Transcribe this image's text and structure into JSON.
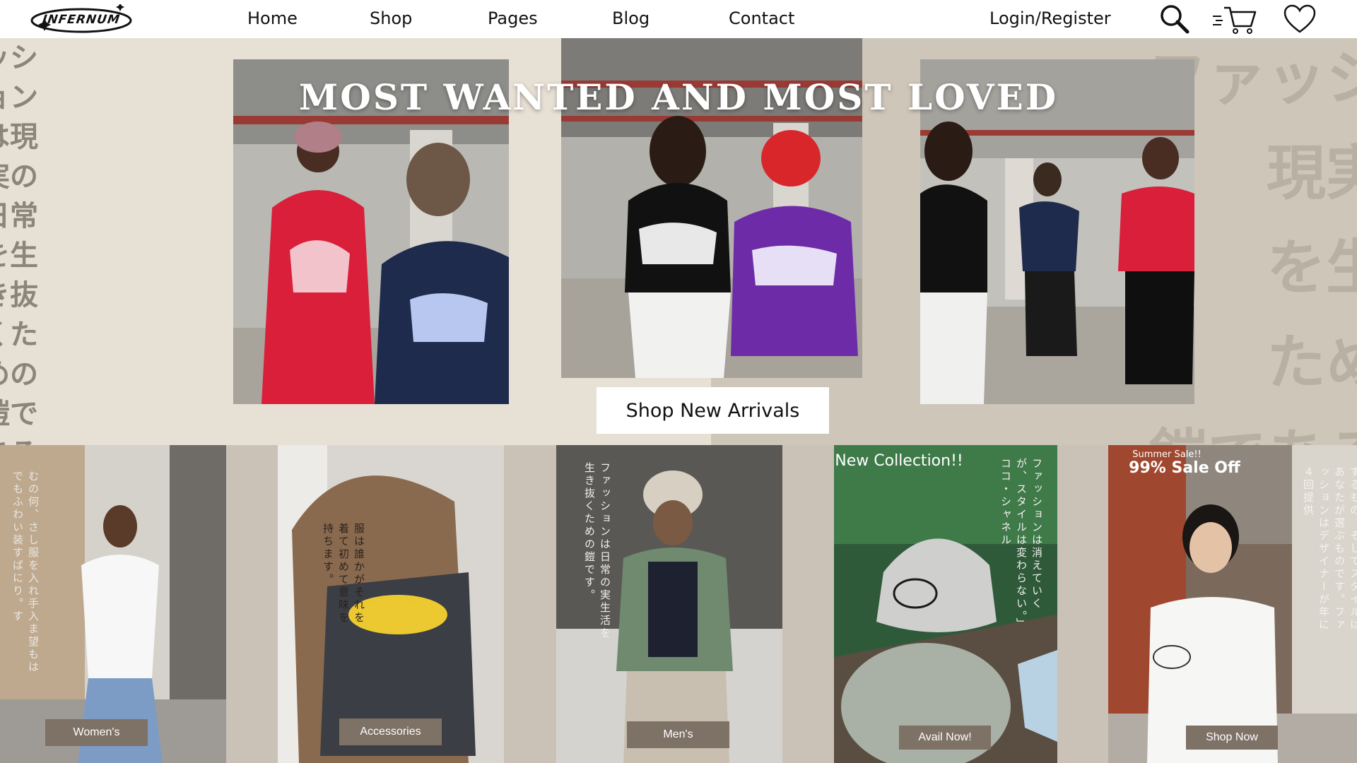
{
  "brand": {
    "logo_text": "INFERNUM"
  },
  "nav": {
    "links": [
      "Home",
      "Shop",
      "Pages",
      "Blog",
      "Contact"
    ],
    "login_label": "Login/Register",
    "icons": [
      "search-icon",
      "cart-icon",
      "heart-icon"
    ]
  },
  "hero": {
    "title": "MOST WANTED AND MOST LOVED",
    "cta_label": "Shop New Arrivals",
    "jp_left_lines": [
      "ッシ",
      "ョン",
      "は現",
      "実の",
      "日常",
      "を生",
      "き抜",
      "くた",
      "めの",
      "鎧で",
      "ある"
    ],
    "jp_right_lines": [
      "ファッシ",
      "現実",
      "を生",
      "ため",
      "鎧である"
    ]
  },
  "categories": [
    {
      "button": "Women's",
      "vertical_text": "むの何、さし服を入れ手入ま望もはでもふわい装すばにり。す"
    },
    {
      "button": "Accessories",
      "vertical_text": "服は誰かがそれを着て初めて意味を持ちます。"
    },
    {
      "button": "Men's",
      "vertical_text": "ファッションは日常の実生活を生き抜くための鎧です。"
    },
    {
      "button": "Avail Now!",
      "title": "New Collection!!",
      "vertical_text": "ファッションは消えていくが、スタイルは変わらない。」ココ・シャネル"
    },
    {
      "button": "Shop Now",
      "small_title": "Summer Sale!!",
      "title": "99% Sale Off",
      "vertical_text": "するもの。そしてスタイルはあなたが選ぶものです。ファッションはデザイナーが年に４回提供"
    }
  ],
  "colors": {
    "hero_bg": "#e7e0d5",
    "hero_right_bg": "#cfc6ba",
    "strip_bg": "#cbc2b7",
    "button_bg": "#7e7166",
    "text_dark": "#111111"
  }
}
